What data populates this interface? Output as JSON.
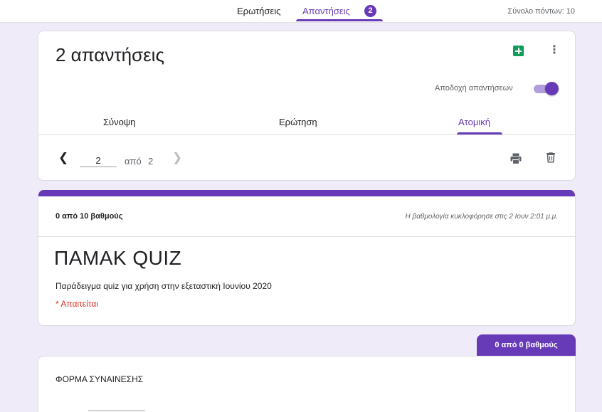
{
  "topbar": {
    "tab_questions": "Ερωτήσεις",
    "tab_responses": "Απαντήσεις",
    "responses_badge": "2",
    "total_points": "Σύνολο πόντων: 10"
  },
  "summary_card": {
    "title": "2 απαντήσεις",
    "accept_label": "Αποδοχή απαντήσεων",
    "accept_enabled": true,
    "sheets_icon": "sheets-icon",
    "more_icon": "more-vert-icon",
    "tabs": [
      {
        "label": "Σύνοψη",
        "active": false
      },
      {
        "label": "Ερώτηση",
        "active": false
      },
      {
        "label": "Ατομική",
        "active": true
      }
    ],
    "pager": {
      "current": "2",
      "of_label": "από",
      "total": "2"
    }
  },
  "response_card": {
    "score": "0 από 10 βαθμούς",
    "released": "Η βαθμολογία κυκλοφόρησε στις 2 Ιουν 2:01 μ.μ.",
    "form_title": "ΠΑΜΑΚ QUIZ",
    "description": "Παράδειγμα quiz για χρήση στην εξεταστική Ιουνίου 2020",
    "required": "* Απαιτείται"
  },
  "section": {
    "score": "0 από 0 βαθμούς",
    "title": "ΦΟΡΜΑ ΣΥΝΑΙΝΕΣΗΣ"
  },
  "colors": {
    "accent": "#673ab7",
    "background": "#f0ebf8",
    "sheets": "#0f9d58",
    "required": "#d93025"
  }
}
